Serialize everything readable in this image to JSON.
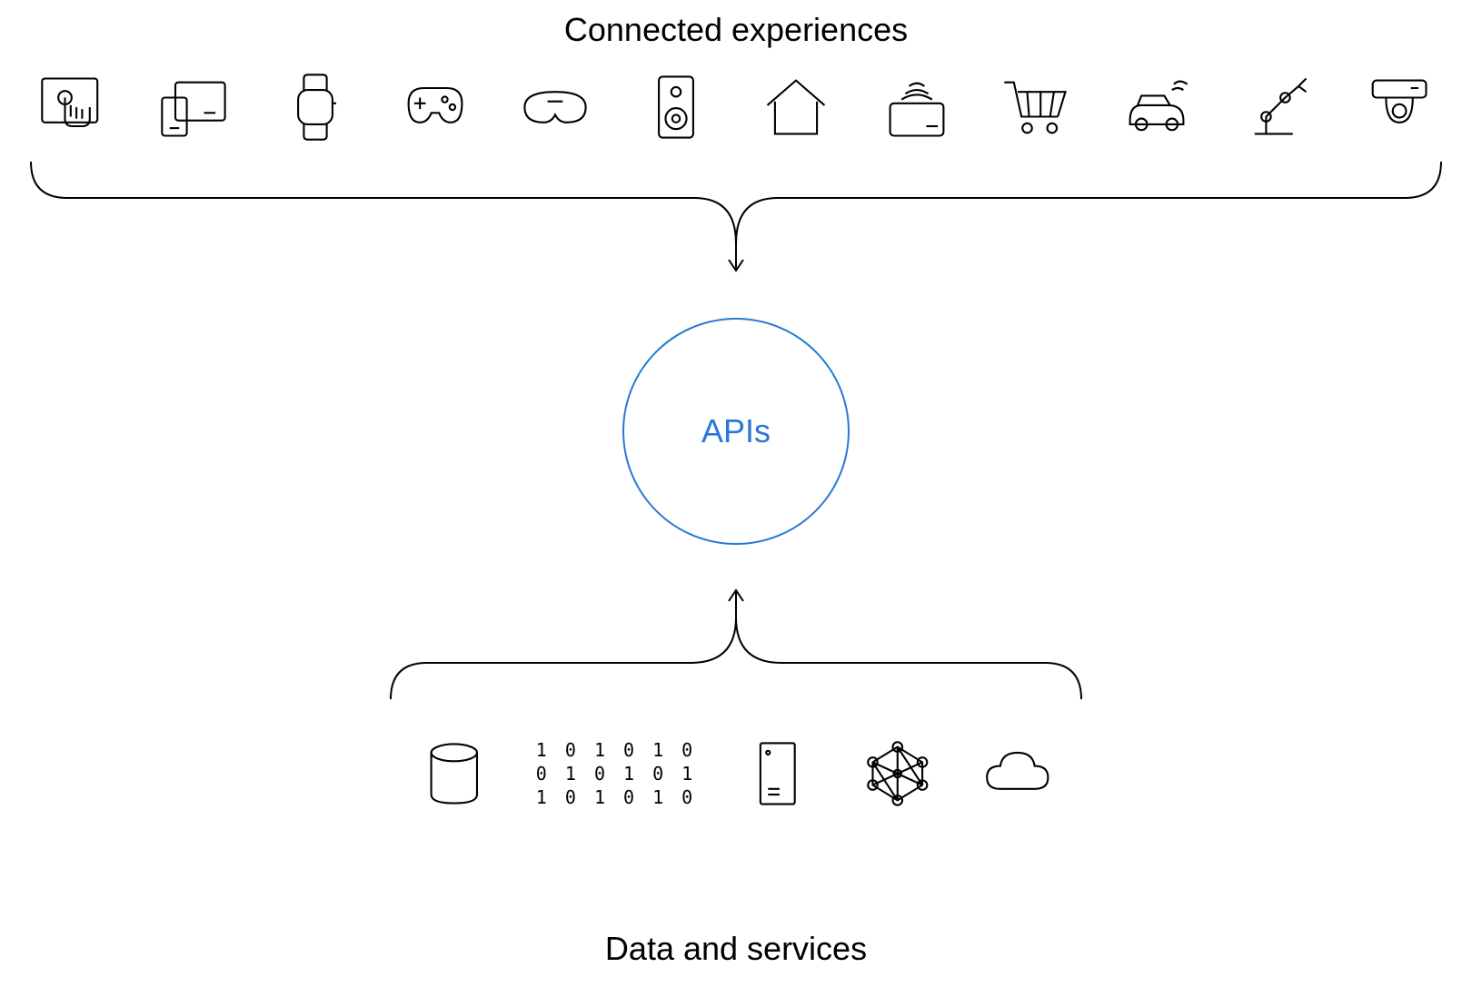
{
  "labels": {
    "top_title": "Connected experiences",
    "bottom_title": "Data and services",
    "center": "APIs"
  },
  "top_icons": [
    "touchscreen-icon",
    "devices-icon",
    "smartwatch-icon",
    "gamepad-icon",
    "vr-headset-icon",
    "speaker-icon",
    "home-icon",
    "contactless-payment-icon",
    "shopping-cart-icon",
    "connected-car-icon",
    "robot-arm-icon",
    "security-camera-icon"
  ],
  "bottom_icons": [
    "database-icon",
    "binary-data-icon",
    "server-icon",
    "network-graph-icon",
    "cloud-icon"
  ],
  "binary_text": "1 0 1 0 1 0\n0 1 0 1 0 1\n1 0 1 0 1 0",
  "colors": {
    "accent": "#2878d4",
    "stroke": "#000000"
  }
}
